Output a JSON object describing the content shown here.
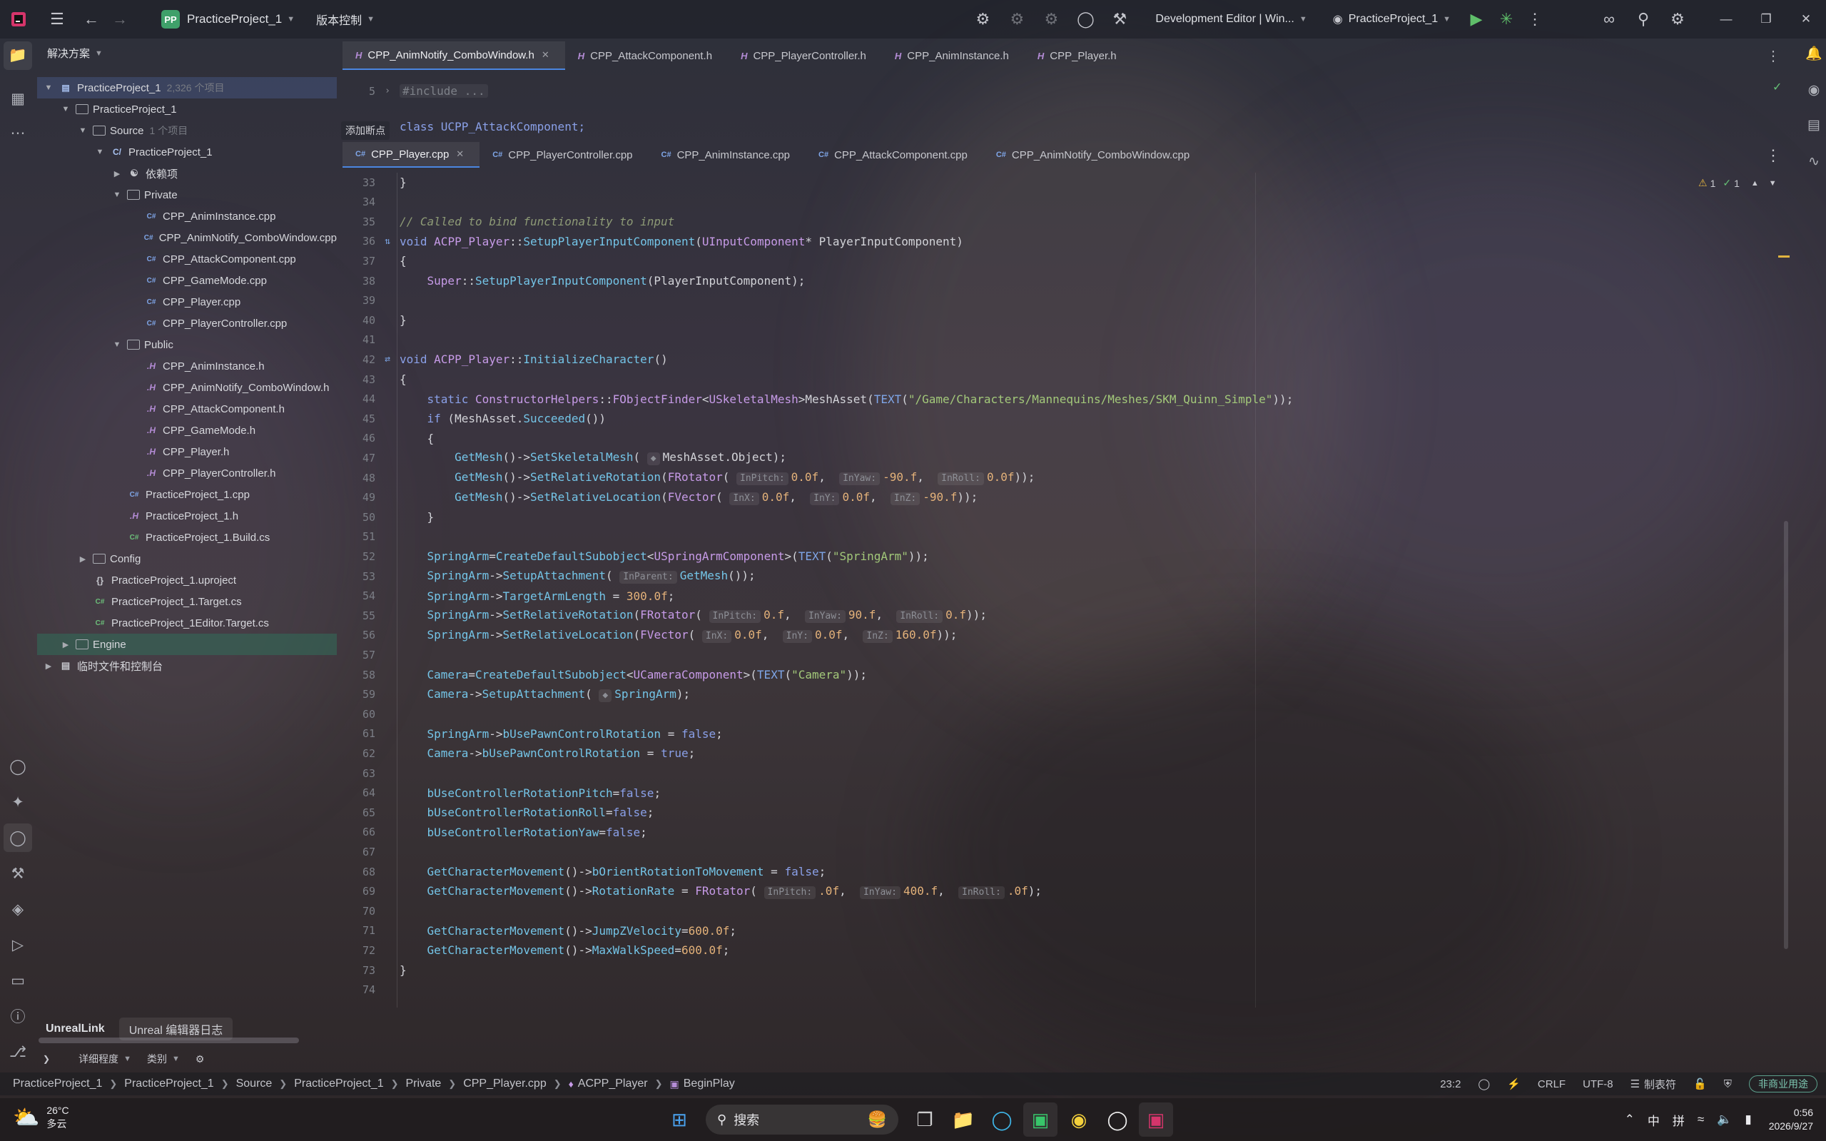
{
  "window": {
    "project_badge": "PP",
    "project_name": "PracticeProject_1",
    "version_control": "版本控制",
    "run_config": "Development Editor | Win...",
    "run_target": "PracticeProject_1"
  },
  "solution": {
    "header": "解决方案",
    "tree": [
      {
        "label": "PracticeProject_1",
        "meta": "2,326 个项目",
        "icon": "solution-icon",
        "level": 0,
        "chev": "v",
        "sel": true
      },
      {
        "label": "PracticeProject_1",
        "meta": "",
        "icon": "folder-icon",
        "level": 1,
        "chev": "v"
      },
      {
        "label": "Source",
        "meta": "1 个项目",
        "icon": "folder-icon",
        "level": 2,
        "chev": "v"
      },
      {
        "label": "PracticeProject_1",
        "meta": "",
        "icon": "project-icon",
        "level": 3,
        "chev": "v"
      },
      {
        "label": "依赖项",
        "meta": "",
        "icon": "dependencies-icon",
        "level": 4,
        "chev": ">"
      },
      {
        "label": "Private",
        "meta": "",
        "icon": "folder-icon",
        "level": 4,
        "chev": "v"
      },
      {
        "label": "CPP_AnimInstance.cpp",
        "meta": "",
        "icon": "cpp-file-icon",
        "level": 5,
        "chev": ""
      },
      {
        "label": "CPP_AnimNotify_ComboWindow.cpp",
        "meta": "",
        "icon": "cpp-file-icon",
        "level": 5,
        "chev": ""
      },
      {
        "label": "CPP_AttackComponent.cpp",
        "meta": "",
        "icon": "cpp-file-icon",
        "level": 5,
        "chev": ""
      },
      {
        "label": "CPP_GameMode.cpp",
        "meta": "",
        "icon": "cpp-file-icon",
        "level": 5,
        "chev": ""
      },
      {
        "label": "CPP_Player.cpp",
        "meta": "",
        "icon": "cpp-file-icon",
        "level": 5,
        "chev": ""
      },
      {
        "label": "CPP_PlayerController.cpp",
        "meta": "",
        "icon": "cpp-file-icon",
        "level": 5,
        "chev": ""
      },
      {
        "label": "Public",
        "meta": "",
        "icon": "folder-icon",
        "level": 4,
        "chev": "v"
      },
      {
        "label": "CPP_AnimInstance.h",
        "meta": "",
        "icon": "header-file-icon",
        "level": 5,
        "chev": ""
      },
      {
        "label": "CPP_AnimNotify_ComboWindow.h",
        "meta": "",
        "icon": "header-file-icon",
        "level": 5,
        "chev": ""
      },
      {
        "label": "CPP_AttackComponent.h",
        "meta": "",
        "icon": "header-file-icon",
        "level": 5,
        "chev": ""
      },
      {
        "label": "CPP_GameMode.h",
        "meta": "",
        "icon": "header-file-icon",
        "level": 5,
        "chev": ""
      },
      {
        "label": "CPP_Player.h",
        "meta": "",
        "icon": "header-file-icon",
        "level": 5,
        "chev": ""
      },
      {
        "label": "CPP_PlayerController.h",
        "meta": "",
        "icon": "header-file-icon",
        "level": 5,
        "chev": ""
      },
      {
        "label": "PracticeProject_1.cpp",
        "meta": "",
        "icon": "cpp-file-icon",
        "level": 4,
        "chev": ""
      },
      {
        "label": "PracticeProject_1.h",
        "meta": "",
        "icon": "header-file-icon",
        "level": 4,
        "chev": ""
      },
      {
        "label": "PracticeProject_1.Build.cs",
        "meta": "",
        "icon": "csharp-file-icon",
        "level": 4,
        "chev": ""
      },
      {
        "label": "Config",
        "meta": "",
        "icon": "folder-icon",
        "level": 2,
        "chev": ">"
      },
      {
        "label": "PracticeProject_1.uproject",
        "meta": "",
        "icon": "uproject-file-icon",
        "level": 2,
        "chev": ""
      },
      {
        "label": "PracticeProject_1.Target.cs",
        "meta": "",
        "icon": "csharp-file-icon",
        "level": 2,
        "chev": ""
      },
      {
        "label": "PracticeProject_1Editor.Target.cs",
        "meta": "",
        "icon": "csharp-file-icon",
        "level": 2,
        "chev": ""
      },
      {
        "label": "Engine",
        "meta": "",
        "icon": "folder-icon",
        "level": 1,
        "chev": ">",
        "hl": true
      },
      {
        "label": "临时文件和控制台",
        "meta": "",
        "icon": "scratch-icon",
        "level": 0,
        "chev": ">"
      }
    ]
  },
  "tabs_top": [
    {
      "label": "CPP_AnimNotify_ComboWindow.h",
      "type": "h",
      "active": true
    },
    {
      "label": "CPP_AttackComponent.h",
      "type": "h"
    },
    {
      "label": "CPP_PlayerController.h",
      "type": "h"
    },
    {
      "label": "CPP_AnimInstance.h",
      "type": "h"
    },
    {
      "label": "CPP_Player.h",
      "type": "h"
    }
  ],
  "tabs_bottom": [
    {
      "label": "CPP_Player.cpp",
      "type": "cpp",
      "active": true
    },
    {
      "label": "CPP_PlayerController.cpp",
      "type": "cpp"
    },
    {
      "label": "CPP_AnimInstance.cpp",
      "type": "cpp"
    },
    {
      "label": "CPP_AttackComponent.cpp",
      "type": "cpp"
    },
    {
      "label": "CPP_AnimNotify_ComboWindow.cpp",
      "type": "cpp"
    }
  ],
  "editor_top": {
    "line5": "5",
    "line5_code": "#include ...",
    "line_partial": "class UCPP_AttackComponent;",
    "add_breakpoint": "添加断点"
  },
  "inspection": {
    "warnings": "1",
    "ok": "1"
  },
  "code_lines": [
    {
      "n": "33",
      "html": "}"
    },
    {
      "n": "34",
      "html": ""
    },
    {
      "n": "35",
      "html": "<span class='cm'>// Called to bind functionality to input</span>"
    },
    {
      "n": "36",
      "g": "impl",
      "html": "<span class='kw'>void</span> <span class='ty'>ACPP_Player</span>::<span class='fn'>SetupPlayerInputComponent</span>(<span class='ty'>UInputComponent</span>* PlayerInputComponent)"
    },
    {
      "n": "37",
      "html": "{"
    },
    {
      "n": "38",
      "html": "    <span class='ty'>Super</span>::<span class='fn'>SetupPlayerInputComponent</span>(PlayerInputComponent);"
    },
    {
      "n": "39",
      "html": ""
    },
    {
      "n": "40",
      "html": "}"
    },
    {
      "n": "41",
      "html": ""
    },
    {
      "n": "42",
      "g": "swap",
      "html": "<span class='kw'>void</span> <span class='ty'>ACPP_Player</span>::<span class='fn'>InitializeCharacter</span>()"
    },
    {
      "n": "43",
      "html": "{"
    },
    {
      "n": "44",
      "html": "    <span class='kw'>static</span> <span class='ty'>ConstructorHelpers</span>::<span class='ty'>FObjectFinder</span>&lt;<span class='ty'>USkeletalMesh</span>&gt;MeshAsset(<span class='mac'>TEXT</span>(<span class='str'>\"/Game/Characters/Mannequins/Meshes/SKM_Quinn_Simple\"</span>));"
    },
    {
      "n": "45",
      "html": "    <span class='kw'>if</span> (MeshAsset.<span class='fn'>Succeeded</span>())"
    },
    {
      "n": "46",
      "html": "    {"
    },
    {
      "n": "47",
      "html": "        <span class='fn'>GetMesh</span>()-&gt;<span class='fn'>SetSkeletalMesh</span>( <span class='hint'>&#9670;</span>MeshAsset.Object);"
    },
    {
      "n": "48",
      "html": "        <span class='fn'>GetMesh</span>()-&gt;<span class='fn'>SetRelativeRotation</span>(<span class='ty'>FRotator</span>( <span class='hint'>InPitch:</span><span class='num'>0.0f</span>,  <span class='hint'>InYaw:</span><span class='num'>-90.f</span>,  <span class='hint'>InRoll:</span><span class='num'>0.0f</span>));"
    },
    {
      "n": "49",
      "html": "        <span class='fn'>GetMesh</span>()-&gt;<span class='fn'>SetRelativeLocation</span>(<span class='ty'>FVector</span>( <span class='hint'>InX:</span><span class='num'>0.0f</span>,  <span class='hint'>InY:</span><span class='num'>0.0f</span>,  <span class='hint'>InZ:</span><span class='num'>-90.f</span>));"
    },
    {
      "n": "50",
      "html": "    }"
    },
    {
      "n": "51",
      "html": ""
    },
    {
      "n": "52",
      "html": "    <span class='fn'>SpringArm</span>=<span class='fn'>CreateDefaultSubobject</span>&lt;<span class='ty'>USpringArmComponent</span>&gt;(<span class='mac'>TEXT</span>(<span class='str'>\"SpringArm\"</span>));"
    },
    {
      "n": "53",
      "html": "    <span class='fn'>SpringArm</span>-&gt;<span class='fn'>SetupAttachment</span>( <span class='hint'>InParent:</span><span class='fn'>GetMesh</span>());"
    },
    {
      "n": "54",
      "html": "    <span class='fn'>SpringArm</span>-&gt;<span class='fn'>TargetArmLength</span> = <span class='num'>300.0f</span>;"
    },
    {
      "n": "55",
      "html": "    <span class='fn'>SpringArm</span>-&gt;<span class='fn'>SetRelativeRotation</span>(<span class='ty'>FRotator</span>( <span class='hint'>InPitch:</span><span class='num'>0.f</span>,  <span class='hint'>InYaw:</span><span class='num'>90.f</span>,  <span class='hint'>InRoll:</span><span class='num'>0.f</span>));"
    },
    {
      "n": "56",
      "html": "    <span class='fn'>SpringArm</span>-&gt;<span class='fn'>SetRelativeLocation</span>(<span class='ty'>FVector</span>( <span class='hint'>InX:</span><span class='num'>0.0f</span>,  <span class='hint'>InY:</span><span class='num'>0.0f</span>,  <span class='hint'>InZ:</span><span class='num'>160.0f</span>));"
    },
    {
      "n": "57",
      "html": ""
    },
    {
      "n": "58",
      "html": "    <span class='fn'>Camera</span>=<span class='fn'>CreateDefaultSubobject</span>&lt;<span class='ty'>UCameraComponent</span>&gt;(<span class='mac'>TEXT</span>(<span class='str'>\"Camera\"</span>));"
    },
    {
      "n": "59",
      "html": "    <span class='fn'>Camera</span>-&gt;<span class='fn'>SetupAttachment</span>( <span class='hint'>&#9670;</span><span class='fn'>SpringArm</span>);"
    },
    {
      "n": "60",
      "html": ""
    },
    {
      "n": "61",
      "html": "    <span class='fn'>SpringArm</span>-&gt;<span class='fn'>bUsePawnControlRotation</span> = <span class='kw'>false</span>;"
    },
    {
      "n": "62",
      "html": "    <span class='fn'>Camera</span>-&gt;<span class='fn'>bUsePawnControlRotation</span> = <span class='kw'>true</span>;"
    },
    {
      "n": "63",
      "html": ""
    },
    {
      "n": "64",
      "html": "    <span class='fn'>bUseControllerRotationPitch</span>=<span class='kw'>false</span>;"
    },
    {
      "n": "65",
      "html": "    <span class='fn'>bUseControllerRotationRoll</span>=<span class='kw'>false</span>;"
    },
    {
      "n": "66",
      "html": "    <span class='fn'>bUseControllerRotationYaw</span>=<span class='kw'>false</span>;"
    },
    {
      "n": "67",
      "html": ""
    },
    {
      "n": "68",
      "html": "    <span class='fn'>GetCharacterMovement</span>()-&gt;<span class='fn'>bOrientRotationToMovement</span> = <span class='kw'>false</span>;"
    },
    {
      "n": "69",
      "html": "    <span class='fn'>GetCharacterMovement</span>()-&gt;<span class='fn'>RotationRate</span> = <span class='ty'>FRotator</span>( <span class='hint'>InPitch:</span><span class='num'>.0f</span>,  <span class='hint'>InYaw:</span><span class='num'>400.f</span>,  <span class='hint'>InRoll:</span><span class='num'>.0f</span>);"
    },
    {
      "n": "70",
      "html": ""
    },
    {
      "n": "71",
      "html": "    <span class='fn'>GetCharacterMovement</span>()-&gt;<span class='fn'>JumpZVelocity</span>=<span class='num'>600.0f</span>;"
    },
    {
      "n": "72",
      "html": "    <span class='fn'>GetCharacterMovement</span>()-&gt;<span class='fn'>MaxWalkSpeed</span>=<span class='num'>600.0f</span>;"
    },
    {
      "n": "73",
      "html": "}"
    },
    {
      "n": "74",
      "html": ""
    }
  ],
  "bottom_panel": {
    "tab_active": "UnrealLink",
    "tab_other": "Unreal 编辑器日志",
    "verbosity": "详细程度",
    "category": "类别"
  },
  "breadcrumb": [
    "PracticeProject_1",
    "PracticeProject_1",
    "Source",
    "PracticeProject_1",
    "Private",
    "CPP_Player.cpp",
    "ACPP_Player",
    "BeginPlay"
  ],
  "status": {
    "position": "23:2",
    "line_ending": "CRLF",
    "encoding": "UTF-8",
    "indent": "制表符",
    "license": "非商业用途"
  },
  "taskbar": {
    "temperature": "26°C",
    "weather": "多云",
    "search_placeholder": "搜索",
    "ime1": "中",
    "ime2": "拼",
    "time": "0:56",
    "date": "2026/9/27"
  },
  "colors": {
    "accent": "#4b86e0",
    "highlight_row": "#326e5a",
    "run_green": "#5fbf6a"
  }
}
